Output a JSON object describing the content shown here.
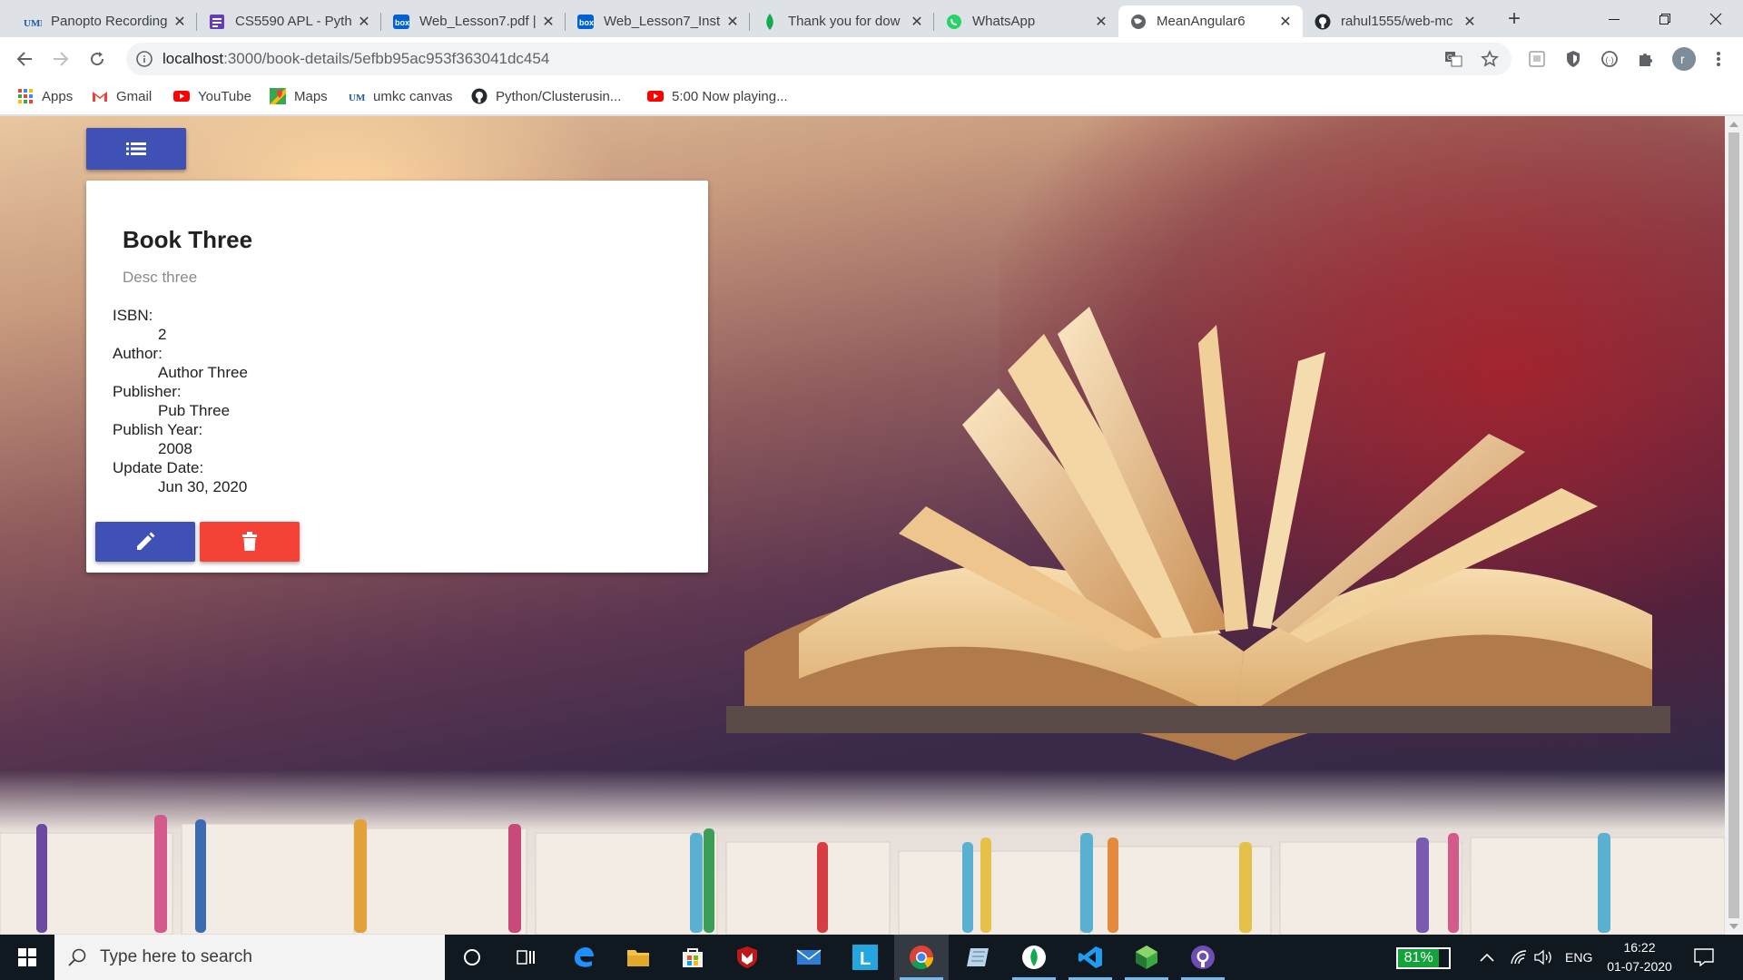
{
  "browser": {
    "tabs": [
      {
        "title": "Panopto Recording",
        "icon": "umkc-icon",
        "active": false
      },
      {
        "title": "CS5590 APL - Pyth",
        "icon": "form-icon",
        "active": false
      },
      {
        "title": "Web_Lesson7.pdf |",
        "icon": "box-icon",
        "active": false
      },
      {
        "title": "Web_Lesson7_Inst",
        "icon": "box-icon",
        "active": false
      },
      {
        "title": "Thank you for dow",
        "icon": "mongodb-leaf-icon",
        "active": false
      },
      {
        "title": "WhatsApp",
        "icon": "whatsapp-icon",
        "active": false
      },
      {
        "title": "MeanAngular6",
        "icon": "globe-icon",
        "active": true
      },
      {
        "title": "rahul1555/web-mc",
        "icon": "github-icon",
        "active": false
      }
    ],
    "url_host": "localhost",
    "url_path": ":3000/book-details/5efbb95ac953f363041dc454",
    "profile_initial": "r",
    "bookmarks": [
      {
        "label": "Apps",
        "icon": "apps-grid-icon"
      },
      {
        "label": "Gmail",
        "icon": "gmail-icon"
      },
      {
        "label": "YouTube",
        "icon": "youtube-icon"
      },
      {
        "label": "Maps",
        "icon": "maps-icon"
      },
      {
        "label": "umkc canvas",
        "icon": "umkc-icon"
      },
      {
        "label": "Python/Clusterusin...",
        "icon": "github-icon"
      },
      {
        "label": "5:00 Now playing...",
        "icon": "youtube-icon"
      }
    ]
  },
  "book": {
    "title": "Book Three",
    "description": "Desc three",
    "fields": [
      {
        "label": "ISBN:",
        "value": "2"
      },
      {
        "label": "Author:",
        "value": "Author Three"
      },
      {
        "label": "Publisher:",
        "value": "Pub Three"
      },
      {
        "label": "Publish Year:",
        "value": "2008"
      },
      {
        "label": "Update Date:",
        "value": "Jun 30, 2020"
      }
    ]
  },
  "colors": {
    "primary": "#3f51b5",
    "warn": "#f44336"
  },
  "taskbar": {
    "search_placeholder": "Type here to search",
    "battery_percent": "81%",
    "battery_level": 0.81,
    "language": "ENG",
    "time": "16:22",
    "date": "01-07-2020"
  }
}
